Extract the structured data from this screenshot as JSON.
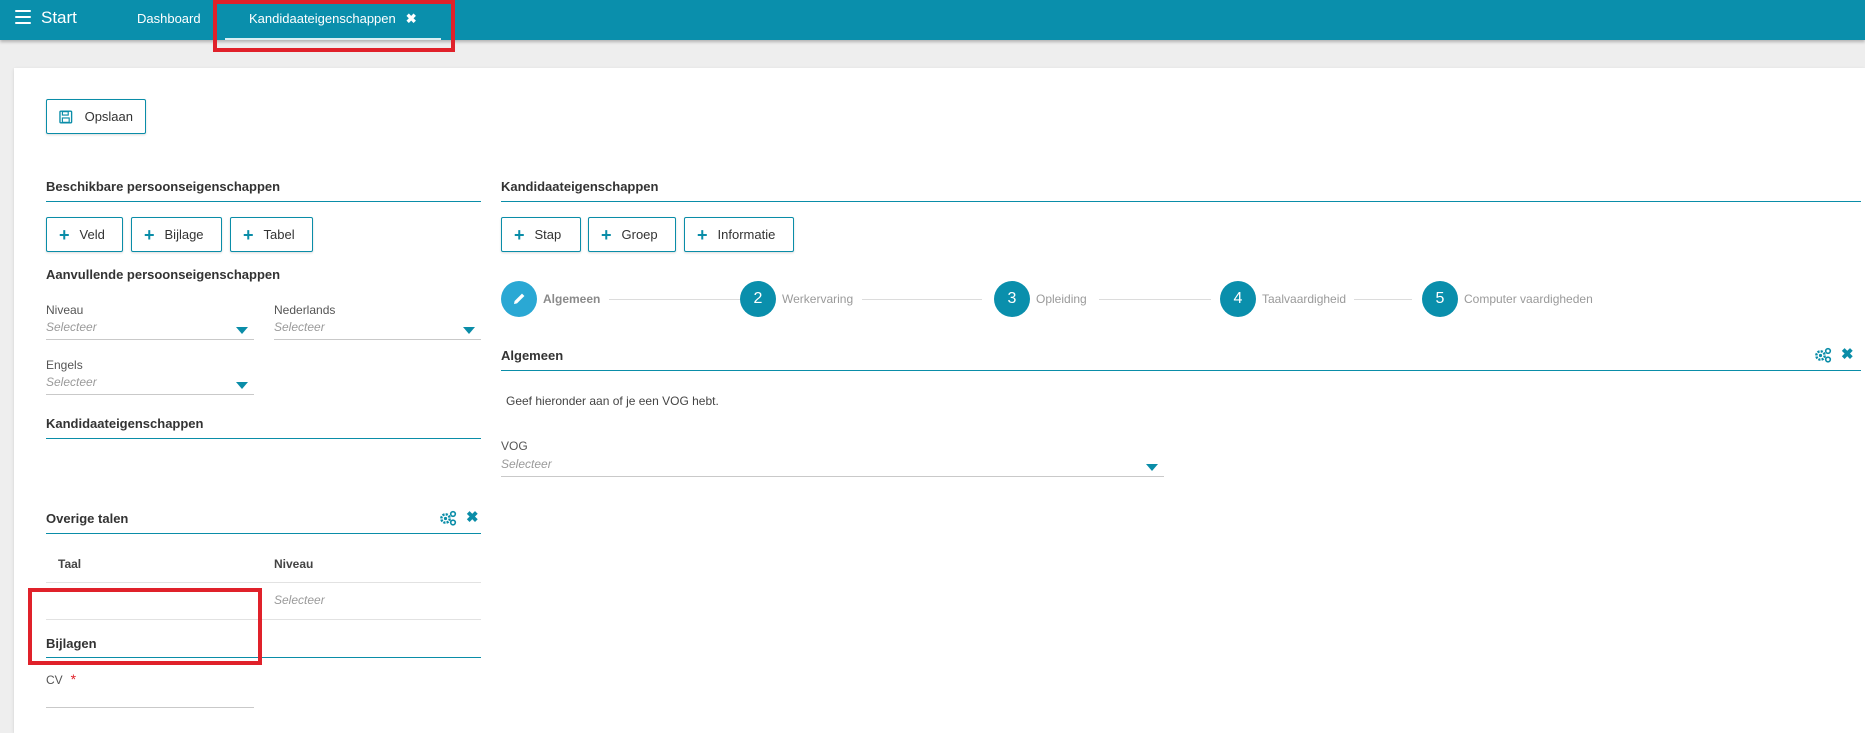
{
  "topbar": {
    "menu_icon": "hamburger-icon",
    "start": "Start",
    "tabs": [
      {
        "label": "Dashboard"
      },
      {
        "label": "Kandidaateigenschappen",
        "close": "✖"
      }
    ]
  },
  "toolbar": {
    "save_label": "Opslaan",
    "save_icon": "floppy-disk-icon"
  },
  "left": {
    "available_title": "Beschikbare persoonseigenschappen",
    "add_buttons": [
      {
        "label": "Veld"
      },
      {
        "label": "Bijlage"
      },
      {
        "label": "Tabel"
      }
    ],
    "extra_title": "Aanvullende persoonseigenschappen",
    "fields": [
      {
        "label": "Niveau",
        "placeholder": "Selecteer"
      },
      {
        "label": "Nederlands",
        "placeholder": "Selecteer"
      },
      {
        "label": "Engels",
        "placeholder": "Selecteer"
      }
    ],
    "candidate_title": "Kandidaateigenschappen",
    "other_languages": {
      "title": "Overige talen",
      "columns": [
        "Taal",
        "Niveau"
      ],
      "row": {
        "taal": "",
        "niveau_placeholder": "Selecteer"
      }
    },
    "attachments": {
      "title": "Bijlagen",
      "cv_label": "CV",
      "required_mark": "*"
    }
  },
  "right": {
    "title": "Kandidaateigenschappen",
    "add_buttons": [
      {
        "label": "Stap"
      },
      {
        "label": "Groep"
      },
      {
        "label": "Informatie"
      }
    ],
    "steps": [
      {
        "number": "",
        "label": "Algemeen",
        "icon": "pencil-icon",
        "active": true
      },
      {
        "number": "2",
        "label": "Werkervaring"
      },
      {
        "number": "3",
        "label": "Opleiding"
      },
      {
        "number": "4",
        "label": "Taalvaardigheid"
      },
      {
        "number": "5",
        "label": "Computer vaardigheden"
      }
    ],
    "group": {
      "title": "Algemeen",
      "description": "Geef hieronder aan of je een VOG hebt.",
      "field_label": "VOG",
      "field_placeholder": "Selecteer"
    }
  },
  "colors": {
    "accent": "#0a8fac",
    "highlight": "#e0212a"
  }
}
